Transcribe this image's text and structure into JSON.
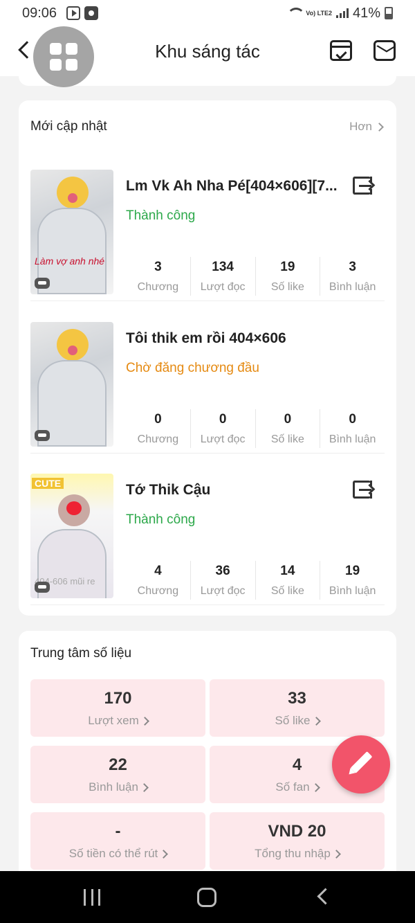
{
  "status_bar": {
    "time": "09:06",
    "network": "Vo) LTE2",
    "battery": "41%"
  },
  "header": {
    "title": "Khu sáng tác"
  },
  "updates": {
    "title": "Mới cập nhật",
    "more": "Hơn",
    "stories": [
      {
        "title": "Lm Vk Ah Nha Pé[404×606][7...",
        "status": "Thành công",
        "status_color": "#2ca84a",
        "cover_text": "Làm vợ anh nhé",
        "stats": [
          {
            "value": "3",
            "label": "Chương"
          },
          {
            "value": "134",
            "label": "Lượt đọc"
          },
          {
            "value": "19",
            "label": "Số like"
          },
          {
            "value": "3",
            "label": "Bình luận"
          }
        ]
      },
      {
        "title": "Tôi thik em rồi 404×606",
        "status": "Chờ đăng chương đầu",
        "status_color": "#e58a12",
        "stats": [
          {
            "value": "0",
            "label": "Chương"
          },
          {
            "value": "0",
            "label": "Lượt đọc"
          },
          {
            "value": "0",
            "label": "Số like"
          },
          {
            "value": "0",
            "label": "Bình luận"
          }
        ]
      },
      {
        "title": "Tớ Thik Cậu",
        "status": "Thành công",
        "status_color": "#2ca84a",
        "cover_text": "CUTE",
        "cover_text2": "404-606 mũi re",
        "stats": [
          {
            "value": "4",
            "label": "Chương"
          },
          {
            "value": "36",
            "label": "Lượt đọc"
          },
          {
            "value": "14",
            "label": "Số like"
          },
          {
            "value": "19",
            "label": "Bình luận"
          }
        ]
      }
    ]
  },
  "data_center": {
    "title": "Trung tâm số liệu",
    "tiles": [
      {
        "value": "170",
        "label": "Lượt xem"
      },
      {
        "value": "33",
        "label": "Số like"
      },
      {
        "value": "22",
        "label": "Bình luận"
      },
      {
        "value": "4",
        "label": "Số fan"
      },
      {
        "value": "-",
        "label": "Số tiền có thể rút"
      },
      {
        "value": "VND 20",
        "label": "Tổng thu nhập"
      }
    ]
  },
  "colors": {
    "accent": "#f2546a",
    "tile_bg": "#fde8eb",
    "success": "#2ca84a",
    "pending": "#e58a12"
  }
}
